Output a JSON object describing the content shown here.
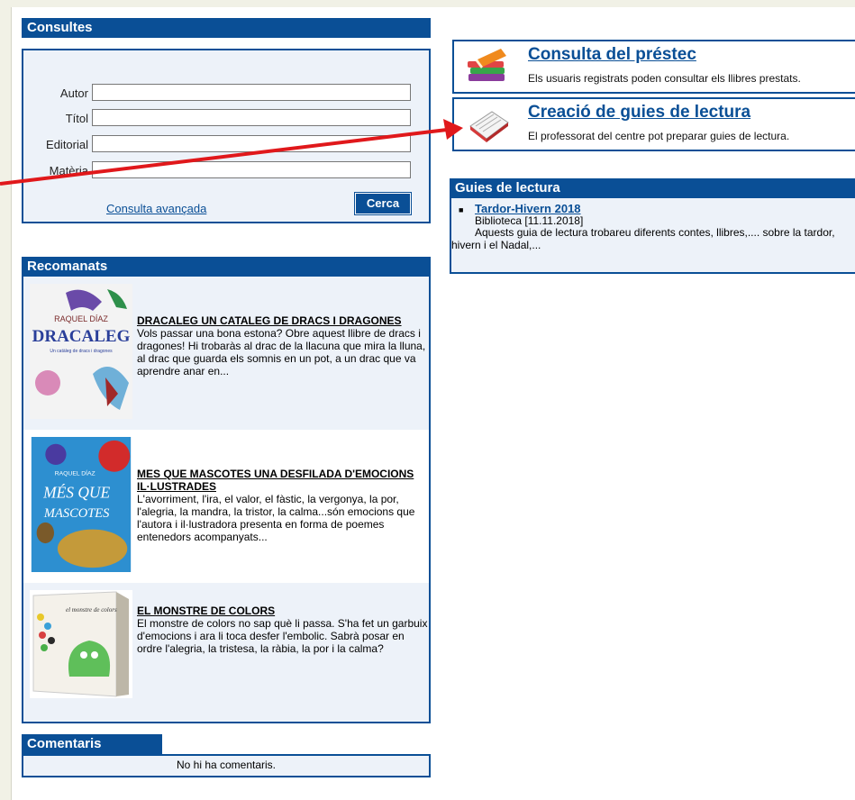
{
  "consultes": {
    "title": "Consultes",
    "fields": [
      {
        "label": "Autor",
        "value": ""
      },
      {
        "label": "Títol",
        "value": ""
      },
      {
        "label": "Editorial",
        "value": ""
      },
      {
        "label": "Matèria",
        "value": ""
      }
    ],
    "advanced_link": "Consulta avançada",
    "search_button": "Cerca"
  },
  "links": [
    {
      "title": "Consulta del préstec",
      "desc": "Els usuaris registrats poden consultar els llibres prestats.",
      "icon": "books-stack-icon"
    },
    {
      "title": "Creació de guies de lectura",
      "desc": "El professorat del centre pot preparar guies de lectura.",
      "icon": "open-book-icon"
    }
  ],
  "guies": {
    "title": "Guies de lectura",
    "items": [
      {
        "title": "Tardor-Hivern 2018",
        "meta": "Biblioteca [11.11.2018]",
        "desc": "Aquests guia de lectura trobareu diferents contes, llibres,.... sobre la tardor, hivern i el Nadal,..."
      }
    ]
  },
  "recomanats": {
    "title": "Recomanats",
    "items": [
      {
        "title": "DRACALEG UN CATALEG DE DRACS I DRAGONES",
        "desc": "Vols passar una bona estona? Obre aquest llibre de dracs i dragones! Hi trobaràs al drac de la llacuna que mira la lluna, al drac que guarda els somnis en un pot, a un drac que va aprendre anar en...",
        "cover_text": [
          "RAQUEL DÍAZ",
          "DRACALEG",
          "Un catàleg de dracs i dragones"
        ],
        "cover_color": "#f3f3f3"
      },
      {
        "title": "MES QUE MASCOTES UNA DESFILADA D'EMOCIONS IL·LUSTRADES",
        "desc": "L'avorriment, l'ira, el valor, el fàstic, la vergonya, la por, l'alegria, la mandra, la tristor, la calma...són emocions que l'autora i il·lustradora presenta en forma de poemes entenedors acompanyats...",
        "cover_text": [
          "RAQUEL DÍAZ",
          "MÉS QUE",
          "MASCOTES"
        ],
        "cover_color": "#2d8fd0"
      },
      {
        "title": "EL MONSTRE DE COLORS",
        "desc": "El monstre de colors no sap què li passa. S'ha fet un garbuix d'emocions i ara li toca desfer l'embolic. Sabrà posar en ordre l'alegria, la tristesa, la ràbia, la por i la calma?",
        "cover_text": [
          "el monstre de colors"
        ],
        "cover_color": "#f4f1ea"
      }
    ]
  },
  "comentaris": {
    "title": "Comentaris",
    "empty": "No hi ha comentaris."
  },
  "colors": {
    "brand": "#0a4f96",
    "panel_bg": "#edf2f9",
    "arrow": "#e0181b"
  }
}
